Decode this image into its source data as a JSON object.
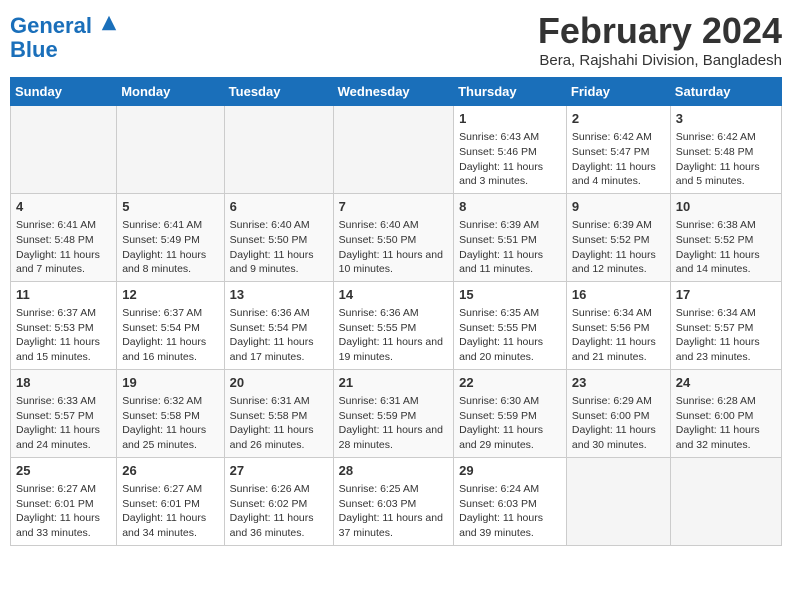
{
  "header": {
    "logo_line1": "General",
    "logo_line2": "Blue",
    "title": "February 2024",
    "subtitle": "Bera, Rajshahi Division, Bangladesh"
  },
  "days_of_week": [
    "Sunday",
    "Monday",
    "Tuesday",
    "Wednesday",
    "Thursday",
    "Friday",
    "Saturday"
  ],
  "weeks": [
    [
      {
        "num": "",
        "info": ""
      },
      {
        "num": "",
        "info": ""
      },
      {
        "num": "",
        "info": ""
      },
      {
        "num": "",
        "info": ""
      },
      {
        "num": "1",
        "info": "Sunrise: 6:43 AM\nSunset: 5:46 PM\nDaylight: 11 hours and 3 minutes."
      },
      {
        "num": "2",
        "info": "Sunrise: 6:42 AM\nSunset: 5:47 PM\nDaylight: 11 hours and 4 minutes."
      },
      {
        "num": "3",
        "info": "Sunrise: 6:42 AM\nSunset: 5:48 PM\nDaylight: 11 hours and 5 minutes."
      }
    ],
    [
      {
        "num": "4",
        "info": "Sunrise: 6:41 AM\nSunset: 5:48 PM\nDaylight: 11 hours and 7 minutes."
      },
      {
        "num": "5",
        "info": "Sunrise: 6:41 AM\nSunset: 5:49 PM\nDaylight: 11 hours and 8 minutes."
      },
      {
        "num": "6",
        "info": "Sunrise: 6:40 AM\nSunset: 5:50 PM\nDaylight: 11 hours and 9 minutes."
      },
      {
        "num": "7",
        "info": "Sunrise: 6:40 AM\nSunset: 5:50 PM\nDaylight: 11 hours and 10 minutes."
      },
      {
        "num": "8",
        "info": "Sunrise: 6:39 AM\nSunset: 5:51 PM\nDaylight: 11 hours and 11 minutes."
      },
      {
        "num": "9",
        "info": "Sunrise: 6:39 AM\nSunset: 5:52 PM\nDaylight: 11 hours and 12 minutes."
      },
      {
        "num": "10",
        "info": "Sunrise: 6:38 AM\nSunset: 5:52 PM\nDaylight: 11 hours and 14 minutes."
      }
    ],
    [
      {
        "num": "11",
        "info": "Sunrise: 6:37 AM\nSunset: 5:53 PM\nDaylight: 11 hours and 15 minutes."
      },
      {
        "num": "12",
        "info": "Sunrise: 6:37 AM\nSunset: 5:54 PM\nDaylight: 11 hours and 16 minutes."
      },
      {
        "num": "13",
        "info": "Sunrise: 6:36 AM\nSunset: 5:54 PM\nDaylight: 11 hours and 17 minutes."
      },
      {
        "num": "14",
        "info": "Sunrise: 6:36 AM\nSunset: 5:55 PM\nDaylight: 11 hours and 19 minutes."
      },
      {
        "num": "15",
        "info": "Sunrise: 6:35 AM\nSunset: 5:55 PM\nDaylight: 11 hours and 20 minutes."
      },
      {
        "num": "16",
        "info": "Sunrise: 6:34 AM\nSunset: 5:56 PM\nDaylight: 11 hours and 21 minutes."
      },
      {
        "num": "17",
        "info": "Sunrise: 6:34 AM\nSunset: 5:57 PM\nDaylight: 11 hours and 23 minutes."
      }
    ],
    [
      {
        "num": "18",
        "info": "Sunrise: 6:33 AM\nSunset: 5:57 PM\nDaylight: 11 hours and 24 minutes."
      },
      {
        "num": "19",
        "info": "Sunrise: 6:32 AM\nSunset: 5:58 PM\nDaylight: 11 hours and 25 minutes."
      },
      {
        "num": "20",
        "info": "Sunrise: 6:31 AM\nSunset: 5:58 PM\nDaylight: 11 hours and 26 minutes."
      },
      {
        "num": "21",
        "info": "Sunrise: 6:31 AM\nSunset: 5:59 PM\nDaylight: 11 hours and 28 minutes."
      },
      {
        "num": "22",
        "info": "Sunrise: 6:30 AM\nSunset: 5:59 PM\nDaylight: 11 hours and 29 minutes."
      },
      {
        "num": "23",
        "info": "Sunrise: 6:29 AM\nSunset: 6:00 PM\nDaylight: 11 hours and 30 minutes."
      },
      {
        "num": "24",
        "info": "Sunrise: 6:28 AM\nSunset: 6:00 PM\nDaylight: 11 hours and 32 minutes."
      }
    ],
    [
      {
        "num": "25",
        "info": "Sunrise: 6:27 AM\nSunset: 6:01 PM\nDaylight: 11 hours and 33 minutes."
      },
      {
        "num": "26",
        "info": "Sunrise: 6:27 AM\nSunset: 6:01 PM\nDaylight: 11 hours and 34 minutes."
      },
      {
        "num": "27",
        "info": "Sunrise: 6:26 AM\nSunset: 6:02 PM\nDaylight: 11 hours and 36 minutes."
      },
      {
        "num": "28",
        "info": "Sunrise: 6:25 AM\nSunset: 6:03 PM\nDaylight: 11 hours and 37 minutes."
      },
      {
        "num": "29",
        "info": "Sunrise: 6:24 AM\nSunset: 6:03 PM\nDaylight: 11 hours and 39 minutes."
      },
      {
        "num": "",
        "info": ""
      },
      {
        "num": "",
        "info": ""
      }
    ]
  ]
}
